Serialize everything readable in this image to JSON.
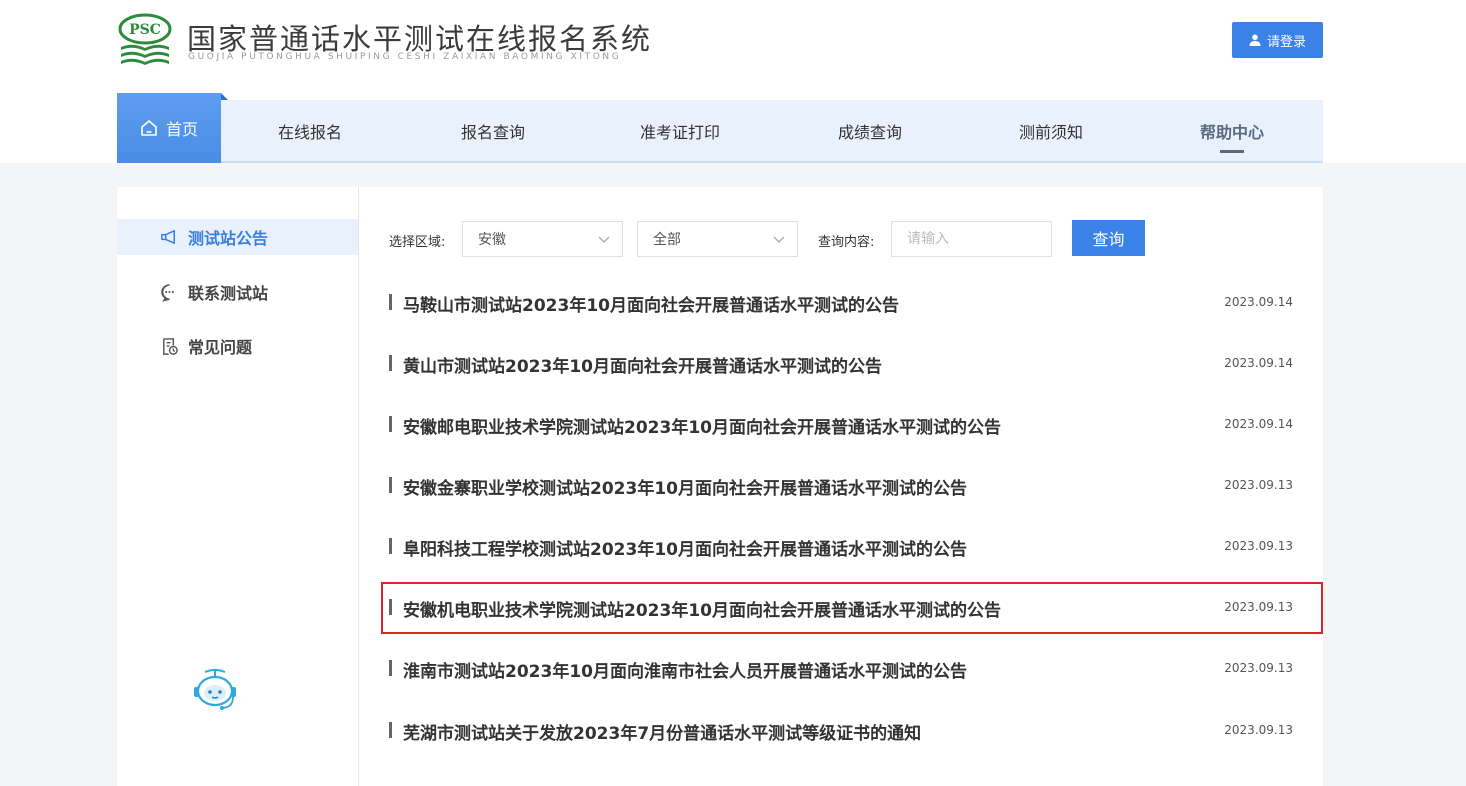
{
  "header": {
    "logo_text": "PSC",
    "title": "国家普通话水平测试在线报名系统",
    "subtitle": "GUOJIA PUTONGHUA SHUIPING CESHI ZAIXIAN BAOMING XITONG",
    "login_label": "请登录"
  },
  "nav": {
    "home": "首页",
    "items": [
      "在线报名",
      "报名查询",
      "准考证打印",
      "成绩查询",
      "测前须知",
      "帮助中心"
    ],
    "active": "帮助中心"
  },
  "sidebar": {
    "items": [
      "测试站公告",
      "联系测试站",
      "常见问题"
    ],
    "active": "测试站公告"
  },
  "filter": {
    "region_label": "选择区域:",
    "region_value": "安徽",
    "category_value": "全部",
    "query_label": "查询内容:",
    "query_placeholder": "请输入",
    "query_button": "查询"
  },
  "announcements": [
    {
      "title": "马鞍山市测试站2023年10月面向社会开展普通话水平测试的公告",
      "date": "2023.09.14"
    },
    {
      "title": "黄山市测试站2023年10月面向社会开展普通话水平测试的公告",
      "date": "2023.09.14"
    },
    {
      "title": "安徽邮电职业技术学院测试站2023年10月面向社会开展普通话水平测试的公告",
      "date": "2023.09.14"
    },
    {
      "title": "安徽金寨职业学校测试站2023年10月面向社会开展普通话水平测试的公告",
      "date": "2023.09.13"
    },
    {
      "title": "阜阳科技工程学校测试站2023年10月面向社会开展普通话水平测试的公告",
      "date": "2023.09.13"
    },
    {
      "title": "安徽机电职业技术学院测试站2023年10月面向社会开展普通话水平测试的公告",
      "date": "2023.09.13"
    },
    {
      "title": "淮南市测试站2023年10月面向淮南市社会人员开展普通话水平测试的公告",
      "date": "2023.09.13"
    },
    {
      "title": "芜湖市测试站关于发放2023年7月份普通话水平测试等级证书的通知",
      "date": "2023.09.13"
    }
  ],
  "highlighted_index": 5,
  "colors": {
    "primary": "#3b82e8",
    "nav_bg": "#e9f1fc",
    "highlight_border": "#d9252b",
    "logo_green": "#2e8b3e"
  }
}
